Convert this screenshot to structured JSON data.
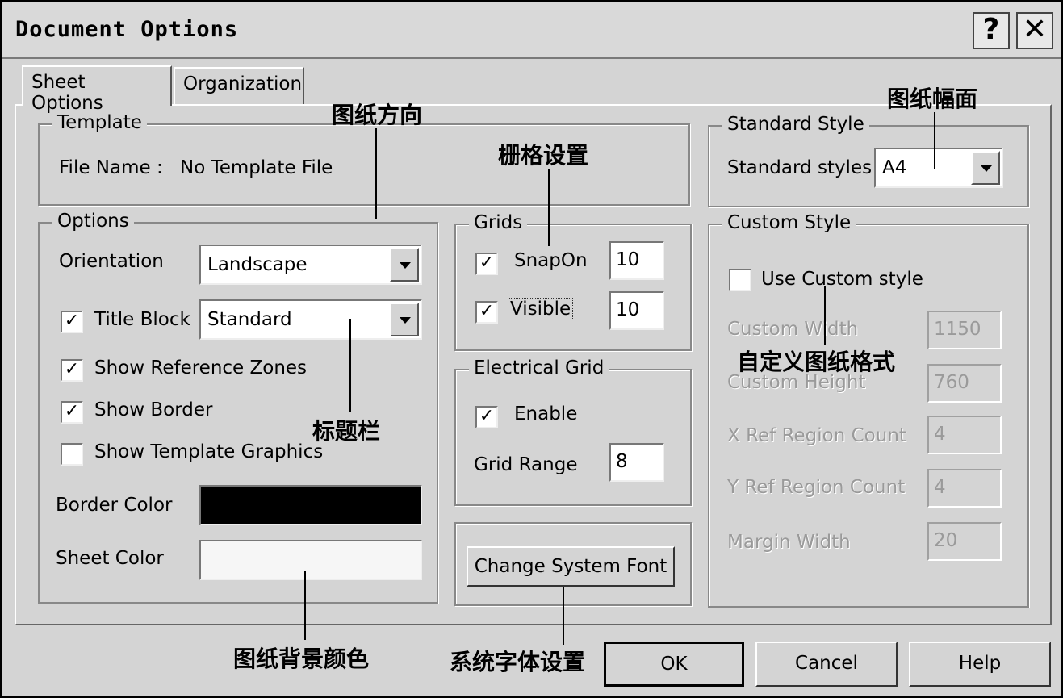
{
  "window": {
    "title": "Document Options",
    "help_glyph": "?",
    "close_glyph": "✕"
  },
  "tabs": [
    {
      "label": "Sheet Options"
    },
    {
      "label": "Organization"
    }
  ],
  "template": {
    "group_label": "Template",
    "file_name_label": "File Name :",
    "file_name_value": "No Template File"
  },
  "options": {
    "group_label": "Options",
    "orientation_label": "Orientation",
    "orientation_value": "Landscape",
    "title_block_label": "Title Block",
    "title_block_checked": true,
    "title_block_value": "Standard",
    "show_reference_zones_label": "Show Reference Zones",
    "show_reference_zones_checked": true,
    "show_border_label": "Show Border",
    "show_border_checked": true,
    "show_template_graphics_label": "Show Template Graphics",
    "show_template_graphics_checked": false,
    "border_color_label": "Border Color",
    "border_color_value": "#000000",
    "sheet_color_label": "Sheet Color",
    "sheet_color_value": "#f6f6f6"
  },
  "grids": {
    "group_label": "Grids",
    "snap_on_label": "SnapOn",
    "snap_on_checked": true,
    "snap_on_value": "10",
    "visible_label": "Visible",
    "visible_checked": true,
    "visible_value": "10"
  },
  "electrical_grid": {
    "group_label": "Electrical Grid",
    "enable_label": "Enable",
    "enable_checked": true,
    "grid_range_label": "Grid Range",
    "grid_range_value": "8"
  },
  "change_font_button": "Change System Font",
  "standard_style": {
    "group_label": "Standard Style",
    "styles_label": "Standard styles",
    "styles_value": "A4"
  },
  "custom_style": {
    "group_label": "Custom Style",
    "use_custom_label": "Use Custom style",
    "use_custom_checked": false,
    "custom_width_label": "Custom Width",
    "custom_width_value": "1150",
    "custom_height_label": "Custom Height",
    "custom_height_value": "760",
    "x_ref_label": "X Ref Region Count",
    "x_ref_value": "4",
    "y_ref_label": "Y Ref Region Count",
    "y_ref_value": "4",
    "margin_width_label": "Margin Width",
    "margin_width_value": "20"
  },
  "buttons": {
    "ok": "OK",
    "cancel": "Cancel",
    "help": "Help"
  },
  "annotations": {
    "orientation": "图纸方向",
    "grid_settings": "栅格设置",
    "sheet_size": "图纸幅面",
    "custom_format": "自定义图纸格式",
    "title_block": "标题栏",
    "sheet_bg_color": "图纸背景颜色",
    "system_font": "系统字体设置"
  }
}
